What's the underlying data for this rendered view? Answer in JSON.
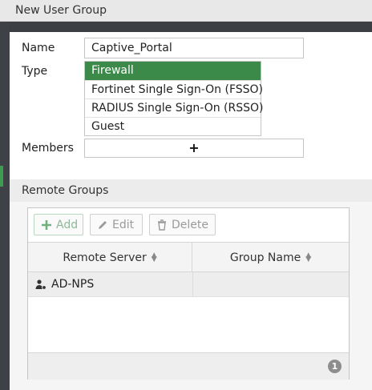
{
  "dialog": {
    "title": "New User Group"
  },
  "form": {
    "name_label": "Name",
    "name_value": "Captive_Portal",
    "type_label": "Type",
    "type_options": [
      "Firewall",
      "Fortinet Single Sign-On (FSSO)",
      "RADIUS Single Sign-On (RSSO)",
      "Guest"
    ],
    "type_selected": "Firewall",
    "members_label": "Members",
    "members_add_glyph": "+"
  },
  "remote_groups": {
    "section_title": "Remote Groups",
    "toolbar": {
      "add_label": "Add",
      "edit_label": "Edit",
      "delete_label": "Delete"
    },
    "columns": [
      "Remote Server",
      "Group Name"
    ],
    "rows": [
      {
        "remote_server": "AD-NPS",
        "group_name": ""
      }
    ],
    "count": "1"
  },
  "colors": {
    "selected": "#3b8a4a",
    "accent": "#3f9b4f"
  },
  "icons": {
    "add": "plus-icon",
    "edit": "pencil-icon",
    "delete": "trash-icon",
    "server": "user-server-icon",
    "sort": "sort-icon"
  }
}
